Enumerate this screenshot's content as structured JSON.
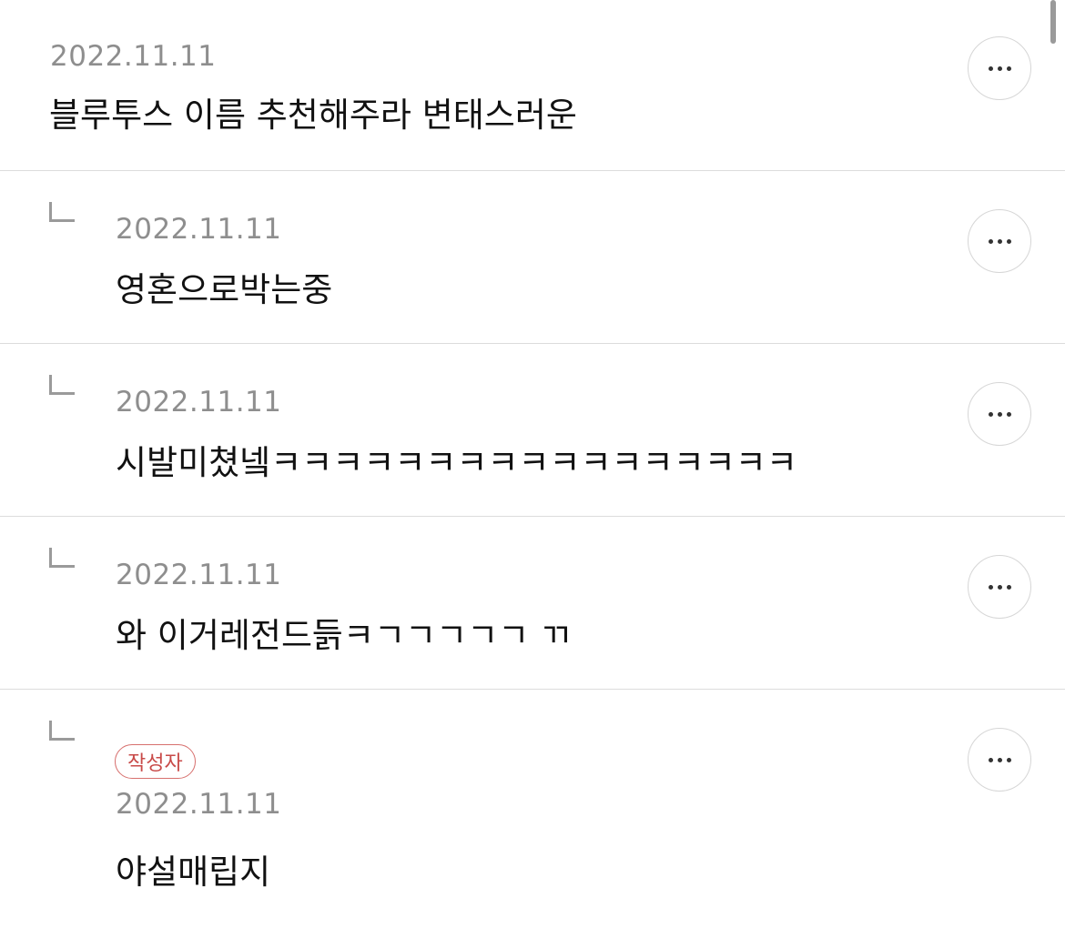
{
  "comments": [
    {
      "date": "2022.11.11",
      "text": "블루투스 이름 추천해주라 변태스러운"
    },
    {
      "date": "2022.11.11",
      "text": "영혼으로박는중"
    },
    {
      "date": "2022.11.11",
      "text": "시발미쳤넼ㅋㅋㅋㅋㅋㅋㅋㅋㅋㅋㅋㅋㅋㅋㅋㅋㅋ"
    },
    {
      "date": "2022.11.11",
      "text": "와 이거레전드듥ㅋㄱㄱㄱㄱㄱ ㄲ"
    },
    {
      "badge": "작성자",
      "date": "2022.11.11",
      "text": "야설매립지"
    }
  ],
  "icons": {
    "more": "more-horizontal-icon",
    "reply": "reply-arrow-icon"
  },
  "colors": {
    "badge_border": "#d7706e",
    "badge_text": "#c84a48",
    "date": "#8e8e8e"
  }
}
